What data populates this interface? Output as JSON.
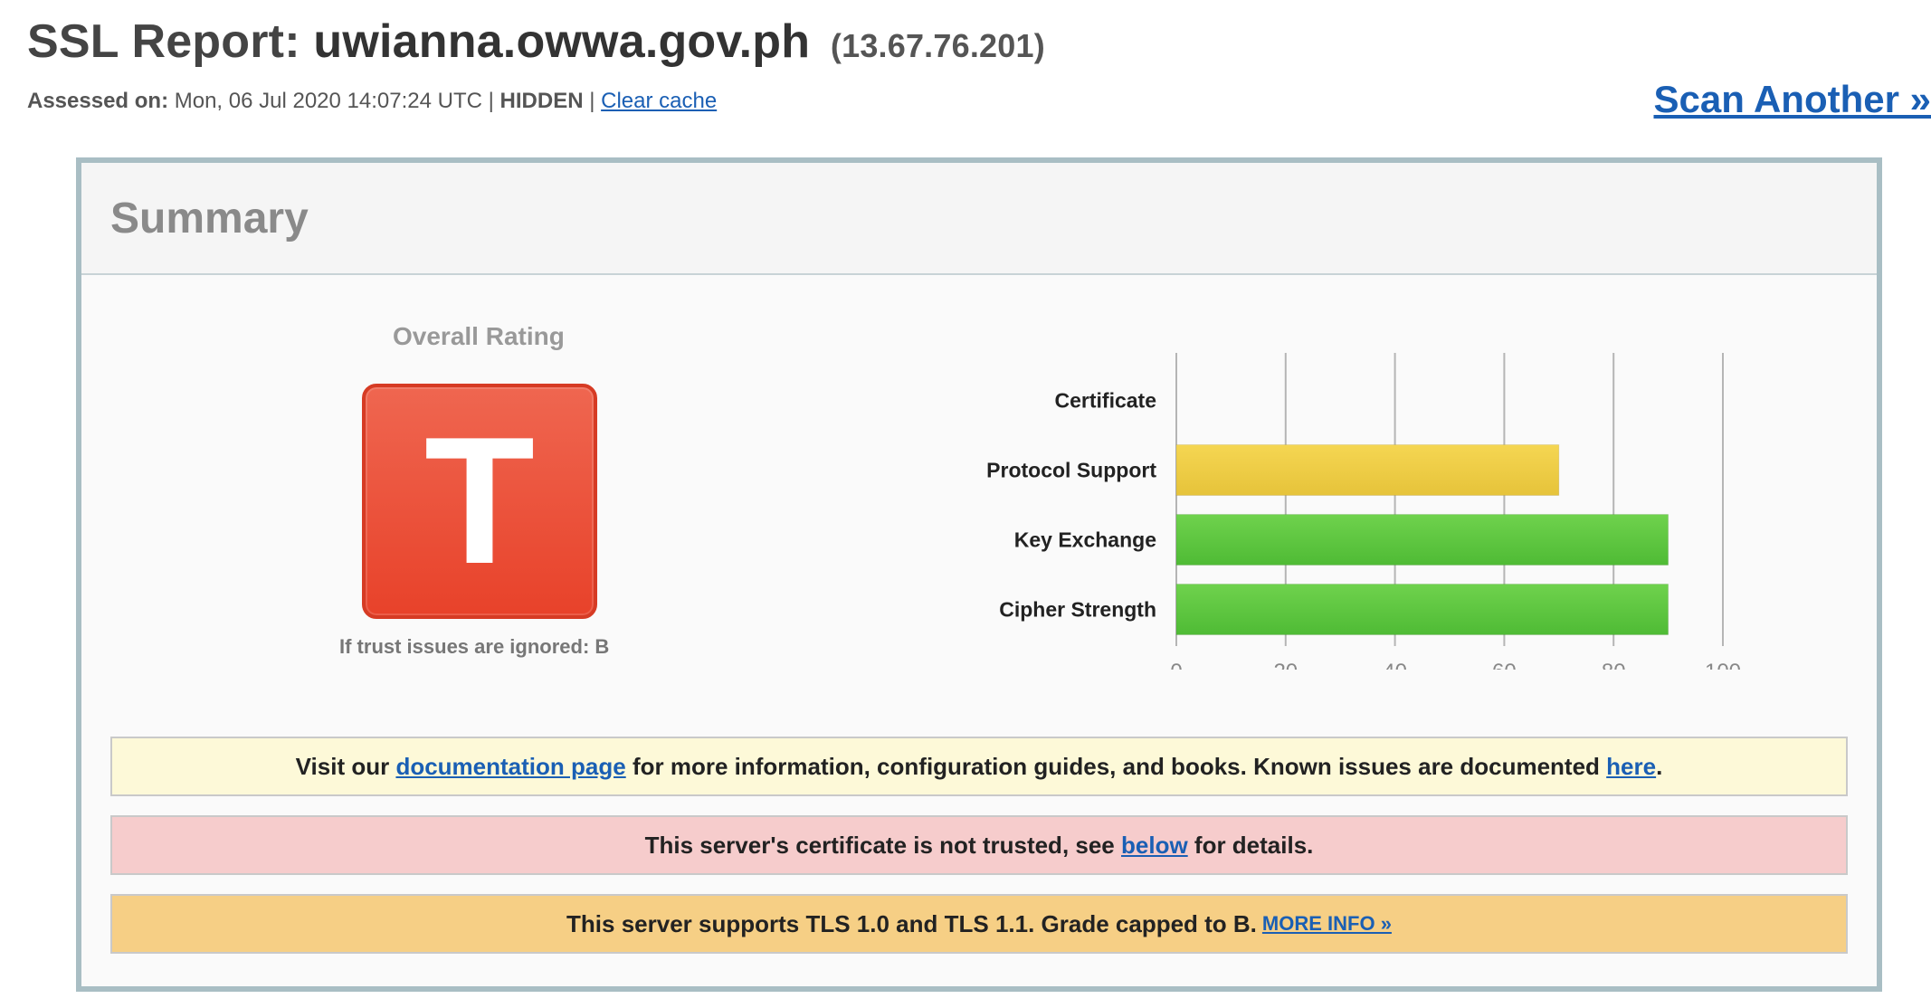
{
  "header": {
    "title_prefix": "SSL Report:",
    "hostname": "uwianna.owwa.gov.ph",
    "ip": "(13.67.76.201)",
    "assessed_label": "Assessed on:",
    "assessed_value": "Mon, 06 Jul 2020 14:07:24 UTC",
    "hidden_label": "HIDDEN",
    "clear_cache": "Clear cache",
    "scan_another": "Scan Another »"
  },
  "summary": {
    "heading": "Summary",
    "rating_label": "Overall Rating",
    "grade": "T",
    "grade_color": "#e8422a",
    "trust_note": "If trust issues are ignored: B"
  },
  "chart_data": {
    "type": "bar",
    "orientation": "horizontal",
    "categories": [
      "Certificate",
      "Protocol Support",
      "Key Exchange",
      "Cipher Strength"
    ],
    "values": [
      0,
      70,
      90,
      90
    ],
    "colors": [
      "#5cc13d",
      "#e6c33a",
      "#4fbb35",
      "#4fbb35"
    ],
    "xlim": [
      0,
      100
    ],
    "ticks": [
      "0",
      "20",
      "40",
      "60",
      "80",
      "100"
    ],
    "grid": true
  },
  "notices": {
    "info": {
      "text_1": "Visit our",
      "link_1": "documentation page",
      "text_2": "for more information, configuration guides, and books. Known issues are documented",
      "link_2": "here",
      "text_3": "."
    },
    "warning": {
      "text_1": "This server's certificate is not trusted, see",
      "link": "below",
      "text_2": "for details."
    },
    "tls": {
      "text": "This server supports TLS 1.0 and TLS 1.1. Grade capped to B.",
      "link": "MORE INFO »"
    }
  }
}
